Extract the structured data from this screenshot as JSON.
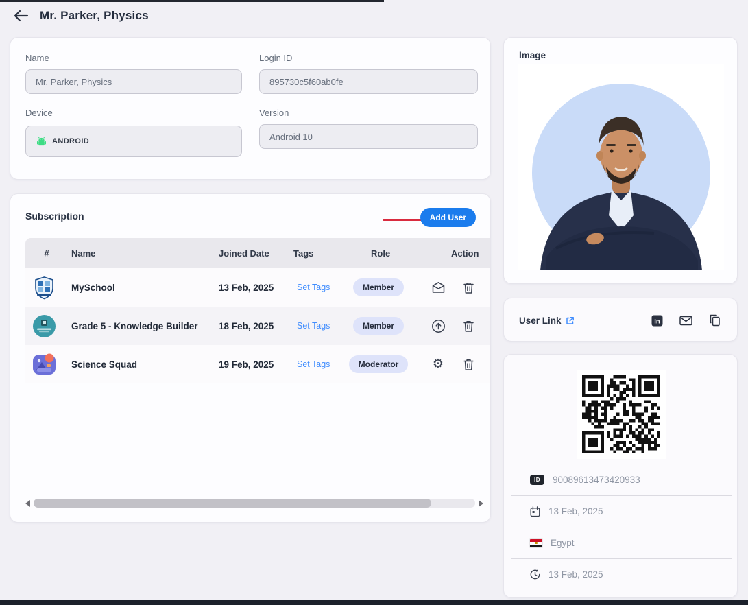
{
  "header": {
    "title": "Mr. Parker, Physics"
  },
  "profile": {
    "name_label": "Name",
    "name_value": "Mr. Parker, Physics",
    "login_label": "Login ID",
    "login_value": "895730c5f60ab0fe",
    "device_label": "Device",
    "device_value": "ANDROID",
    "version_label": "Version",
    "version_value": "Android 10"
  },
  "subscription": {
    "title": "Subscription",
    "add_user_label": "Add User",
    "columns": {
      "num": "#",
      "name": "Name",
      "joined": "Joined Date",
      "tags": "Tags",
      "role": "Role",
      "action": "Action"
    },
    "rows": [
      {
        "name": "MySchool",
        "joined": "13 Feb, 2025",
        "tags_link": "Set Tags",
        "role": "Member"
      },
      {
        "name": "Grade 5 - Knowledge Builder",
        "joined": "18 Feb, 2025",
        "tags_link": "Set Tags",
        "role": "Member"
      },
      {
        "name": "Science Squad",
        "joined": "19 Feb, 2025",
        "tags_link": "Set Tags",
        "role": "Moderator"
      }
    ]
  },
  "image_card": {
    "title": "Image"
  },
  "user_link_card": {
    "title": "User Link",
    "icons": [
      "linkedin-icon",
      "mail-icon",
      "copy-icon"
    ]
  },
  "qr_card": {
    "id_value": "90089613473420933",
    "date_top": "13 Feb, 2025",
    "country": "Egypt",
    "date_bottom": "13 Feb, 2025"
  },
  "colors": {
    "accent_blue": "#1b7ced",
    "link_blue": "#3f8cfe",
    "badge_bg": "#dee3fa",
    "arrow_red": "#d92b3f",
    "android_green": "#3ddc84",
    "page_bg": "#f1f0f5"
  }
}
